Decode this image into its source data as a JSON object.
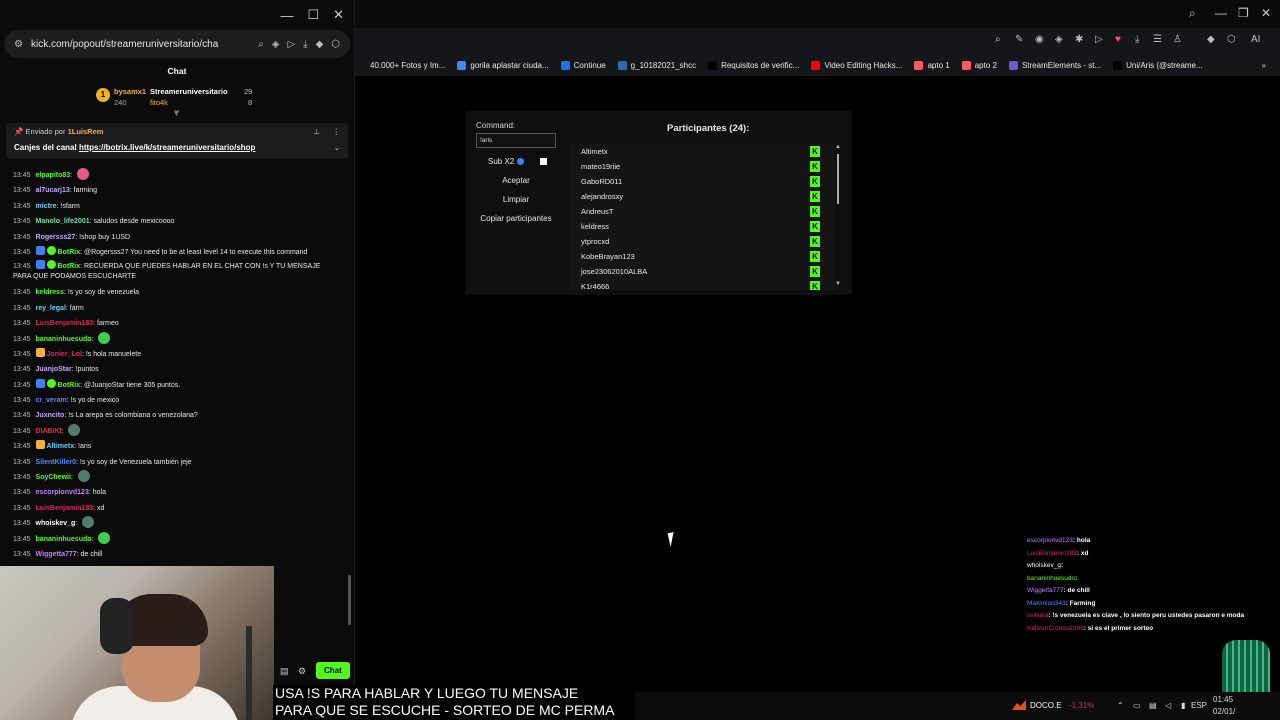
{
  "popout": {
    "window_controls": [
      "—",
      "☐",
      "✕"
    ],
    "url": "kick.com/popout/streameruniversitario/cha",
    "chat_title": "Chat",
    "leaderboard": {
      "first_user": "bysamx1",
      "first_points": "240",
      "second_user": "Streameruniversitario",
      "third_user": "fito4k",
      "second_count": "29",
      "third_count": "8",
      "coin_label": "1"
    },
    "pinned": {
      "sent_by_label": "Enviado por",
      "sent_by_user": "1LuisRem",
      "message_prefix": "Canjes del canal",
      "link": "https://botrix.live/k/streameruniversitario/shop"
    },
    "messages": [
      {
        "time": "13:45",
        "user": "elpapito83",
        "text": "",
        "color": "#53fc18",
        "emote": "#e55a8a"
      },
      {
        "time": "13:45",
        "user": "al7ucarj13",
        "text": "farming",
        "color": "#c7a8ff"
      },
      {
        "time": "13:45",
        "user": "mictre",
        "text": "!sfarm",
        "color": "#67d1ff"
      },
      {
        "time": "13:45",
        "user": "Manolo_life2001",
        "text": "saludos desde mexicoooo",
        "color": "#6fe3a8"
      },
      {
        "time": "13:45",
        "user": "Rogersss27",
        "text": "!shop buy 1USD",
        "color": "#c7a8ff"
      },
      {
        "time": "13:45",
        "user": "BotRix",
        "text": "@Rogersss27 You need to be at least level 14 to execute this command",
        "color": "#53fc18",
        "bot": true
      },
      {
        "time": "13:45",
        "user": "BotRix",
        "text": "RECUERDA QUE PUEDES HABLAR EN EL CHAT CON !s Y TU MENSAJE PARA QUE PODAMOS ESCUCHARTE",
        "color": "#53fc18",
        "bot": true,
        "two": true
      },
      {
        "time": "13:45",
        "user": "keldress",
        "text": "!s yo soy de venezuela",
        "color": "#53fc18"
      },
      {
        "time": "13:45",
        "user": "rey_legal",
        "text": "farm",
        "color": "#67d1ff"
      },
      {
        "time": "13:45",
        "user": "LuisBenjamin183",
        "text": "farmeo",
        "color": "#e0245e"
      },
      {
        "time": "13:45",
        "user": "bananinhuesudo",
        "text": "",
        "color": "#53fc18",
        "emote": "#3ccf4e"
      },
      {
        "time": "13:45",
        "user": "Jonier_Lol",
        "text": "!s hola manuelete",
        "color": "#e0245e",
        "crown": true
      },
      {
        "time": "13:45",
        "user": "JuanjoStar",
        "text": "!puntos",
        "color": "#c7a8ff"
      },
      {
        "time": "13:45",
        "user": "BotRix",
        "text": "@JuanjoStar tiene 305 puntos.",
        "color": "#53fc18",
        "bot": true
      },
      {
        "time": "13:45",
        "user": "cr_veram",
        "text": "!s yo de mexico",
        "color": "#4b8bff"
      },
      {
        "time": "13:45",
        "user": "Juxncito",
        "text": "!s La arepa es colombiana o venezolana?",
        "color": "#c7a8ff"
      },
      {
        "time": "13:45",
        "user": "DIABIKI",
        "text": "",
        "color": "#e0245e",
        "emote": "#557b6b"
      },
      {
        "time": "13:45",
        "user": "Altimetx",
        "text": "!aris",
        "color": "#67d1ff",
        "crown": true
      },
      {
        "time": "13:45",
        "user": "SilentKiller0",
        "text": "!s yo soy de Venezuela también jeje",
        "color": "#4b8bff"
      },
      {
        "time": "13:45",
        "user": "SoyChewii",
        "text": "",
        "color": "#53fc18",
        "emote": "#557b6b"
      },
      {
        "time": "13:45",
        "user": "escorpionvd123",
        "text": "hola",
        "color": "#c77dff"
      },
      {
        "time": "13:45",
        "user": "LuisBenjamin183",
        "text": "xd",
        "color": "#e0245e"
      },
      {
        "time": "13:45",
        "user": "whoiskev_g",
        "text": "",
        "color": "#ffffff",
        "emote": "#557b6b"
      },
      {
        "time": "13:45",
        "user": "bananinhuesudo",
        "text": "",
        "color": "#53fc18",
        "emote": "#3ccf4e"
      },
      {
        "time": "13:45",
        "user": "Wiggetta777",
        "text": "de chill",
        "color": "#c77dff"
      }
    ],
    "chat_button": "Chat"
  },
  "browser": {
    "window_controls": [
      "—",
      "❐",
      "✕"
    ],
    "bookmarks": [
      {
        "label": "40.000+ Fotos y Im...",
        "color": "#15161a"
      },
      {
        "label": "gorila aplastar ciuda...",
        "color": "#4285f4"
      },
      {
        "label": "Continue",
        "color": "#1a73e8"
      },
      {
        "label": "g_10182021_shcc",
        "color": "#2b6cb0"
      },
      {
        "label": "Requisitos de verific...",
        "color": "#000000"
      },
      {
        "label": "Video Editing Hacks...",
        "color": "#ff0000"
      },
      {
        "label": "apto 1",
        "color": "#ff5a5f"
      },
      {
        "label": "apto 2",
        "color": "#ff5a5f"
      },
      {
        "label": "StreamElements - st...",
        "color": "#6a5acd"
      },
      {
        "label": "Uni/Aris (@streame...",
        "color": "#000000"
      }
    ],
    "toolbar_ai": "AI"
  },
  "widget": {
    "command_label": "Command:",
    "command_value": "!aris",
    "sub_label": "Sub X2",
    "accept": "Aceptar",
    "clear": "Limpiar",
    "copy": "Copiar participantes",
    "participants_title": "Participantes (24):",
    "participants": [
      "Altimetx",
      "mateo19riie",
      "GaboRD011",
      "alejandrosxy",
      "AndreusT",
      "keldress",
      "ytprocxd",
      "KobeBrayan123",
      "jose23062010ALBA",
      "K1r4666"
    ]
  },
  "overlay_chat": [
    {
      "user": "escorpionvd123",
      "text": ": hola",
      "color": "#c77dff"
    },
    {
      "user": "LuisBenjamin183",
      "text": ": xd",
      "color": "#e0245e"
    },
    {
      "user": "whoiskev_g",
      "text": ":",
      "color": "#ffffff"
    },
    {
      "user": "bananinhuesudo",
      "text": ":",
      "color": "#53fc18"
    },
    {
      "user": "Wiggetta777",
      "text": ": de chill",
      "color": "#c77dff"
    },
    {
      "user": "Maximiun343",
      "text": ": Farming",
      "color": "#4b8bff"
    },
    {
      "user": "svilluka",
      "text": ": !s venezuela es clave , lo siento peru ustedes pasaron e moda",
      "color": "#e0245e"
    },
    {
      "user": "KelivanCronos2399",
      "text": ": si es el primer sorteo",
      "color": "#e0245e"
    }
  ],
  "subtitle": {
    "line1": "USA !S PARA HABLAR Y LUEGO TU MENSAJE",
    "line2": "PARA QUE SE ESCUCHE - SORTEO DE MC PERMA"
  },
  "taskbar": {
    "stock_name": "DOCO.E",
    "stock_change": "-1,31%",
    "lang": "ESP",
    "time": "01:45",
    "date": "02/01/"
  }
}
